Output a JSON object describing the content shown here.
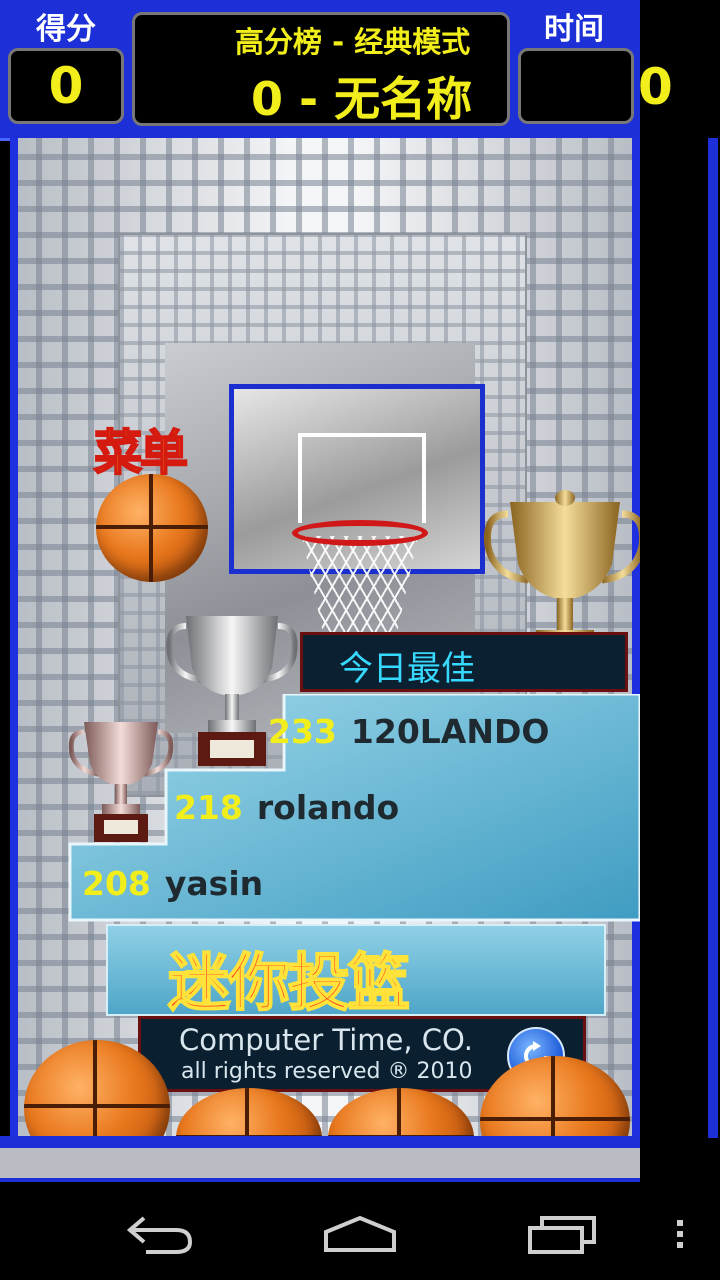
{
  "hud": {
    "score_label": "得分",
    "score_value": "0",
    "time_label": "时间",
    "time_value": "0",
    "highscore_title": "高分榜 - 经典模式",
    "highscore_entry": "0 - 无名称"
  },
  "game": {
    "menu_label": "菜单",
    "today_best_label": "今日最佳",
    "leaderboard": [
      {
        "score": "233",
        "name": "120LANDO"
      },
      {
        "score": "218",
        "name": "rolando"
      },
      {
        "score": "208",
        "name": "yasin"
      }
    ],
    "title": "迷你投篮",
    "credit_line1": "Computer Time, CO.",
    "credit_line2": "all rights reserved ® 2010"
  },
  "icons": {
    "refresh": "refresh-icon",
    "back": "back-icon",
    "home": "home-icon",
    "recents": "recents-icon",
    "overflow": "overflow-icon"
  },
  "colors": {
    "hud_blue": "#1d2fd6",
    "score_yellow": "#f2ee1c",
    "title_red": "#ff2a1a",
    "today_cyan": "#37d9ff"
  }
}
